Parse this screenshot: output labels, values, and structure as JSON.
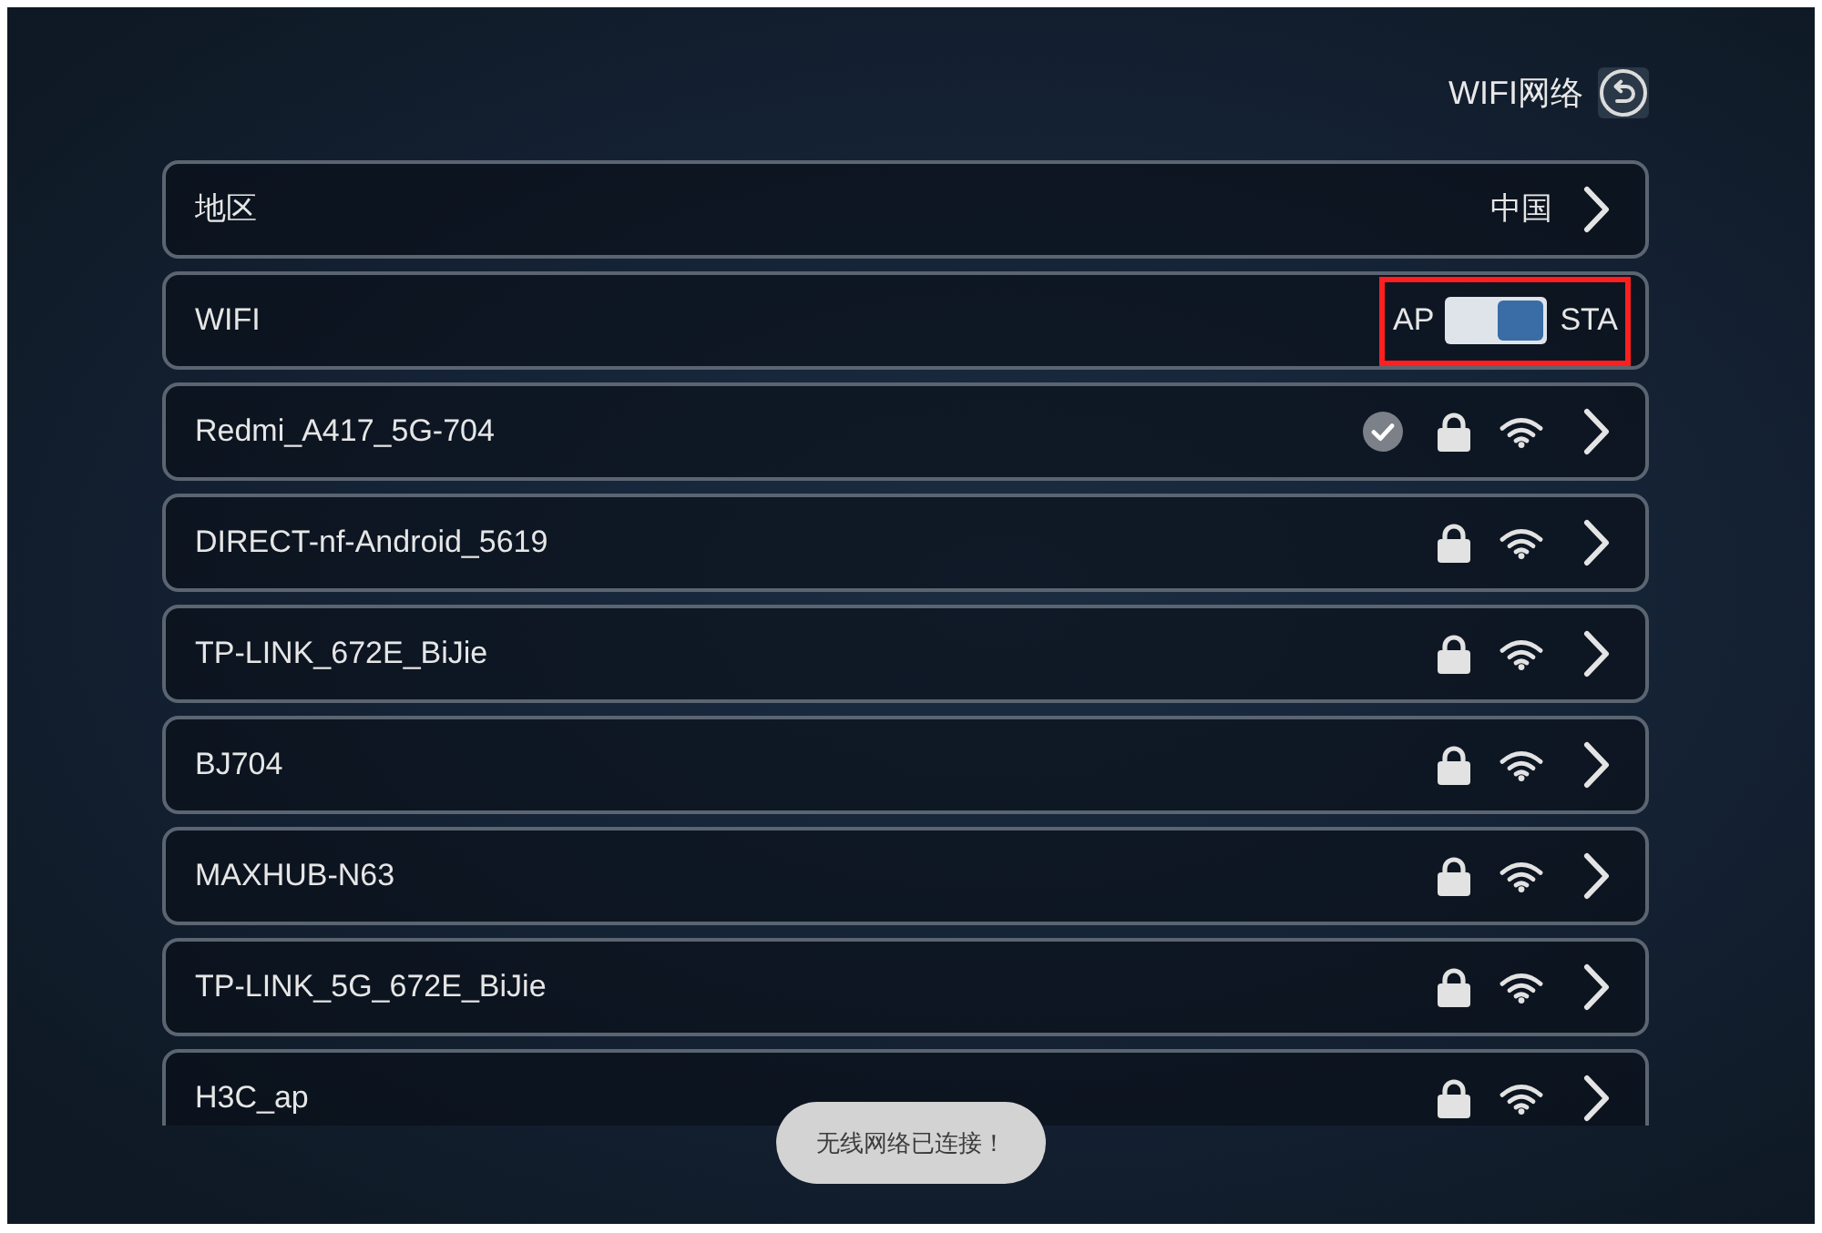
{
  "header": {
    "title": "WIFI网络"
  },
  "settings": [
    {
      "kind": "link",
      "label": "地区",
      "value": "中国",
      "highlighted": false
    },
    {
      "kind": "switch",
      "label": "WIFI",
      "off_label": "AP",
      "on_label": "STA",
      "on": true,
      "highlighted": true
    }
  ],
  "networks": [
    {
      "name": "Redmi_A417_5G-704",
      "connected": true,
      "secured": true
    },
    {
      "name": "DIRECT-nf-Android_5619",
      "connected": false,
      "secured": true
    },
    {
      "name": "TP-LINK_672E_BiJie",
      "connected": false,
      "secured": true
    },
    {
      "name": "BJ704",
      "connected": false,
      "secured": true
    },
    {
      "name": "MAXHUB-N63",
      "connected": false,
      "secured": true
    },
    {
      "name": "TP-LINK_5G_672E_BiJie",
      "connected": false,
      "secured": true
    },
    {
      "name": "H3C_ap",
      "connected": false,
      "secured": true
    }
  ],
  "toast": "无线网络已连接！"
}
